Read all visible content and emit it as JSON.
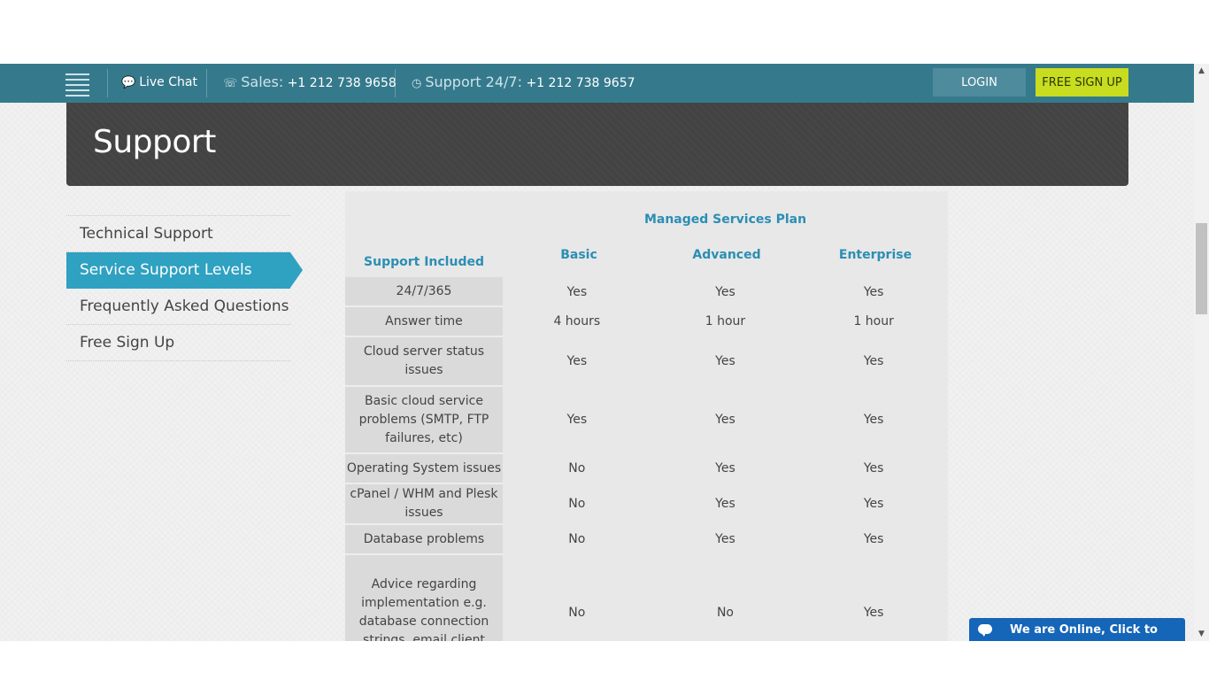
{
  "topbar": {
    "live_chat": "Live Chat",
    "sales_label": "Sales:",
    "sales_number": "+1 212 738 9658",
    "support_label": "Support 24/7:",
    "support_number": "+1 212 738 9657",
    "login": "LOGIN",
    "signup": "FREE SIGN UP"
  },
  "hero": {
    "title": "Support"
  },
  "sidebar": {
    "items": [
      {
        "label": "Technical Support"
      },
      {
        "label": "Service Support Levels"
      },
      {
        "label": "Frequently Asked Questions"
      },
      {
        "label": "Free Sign Up"
      }
    ],
    "active_index": 1
  },
  "table": {
    "plan_title": "Managed Services Plan",
    "support_header": "Support Included",
    "columns": [
      "Basic",
      "Advanced",
      "Enterprise"
    ],
    "rows": [
      {
        "label": "24/7/365",
        "values": [
          "Yes",
          "Yes",
          "Yes"
        ]
      },
      {
        "label": "Answer time",
        "values": [
          "4 hours",
          "1 hour",
          "1 hour"
        ]
      },
      {
        "label": "Cloud server status issues",
        "values": [
          "Yes",
          "Yes",
          "Yes"
        ]
      },
      {
        "label": "Basic cloud service problems (SMTP, FTP failures, etc)",
        "values": [
          "Yes",
          "Yes",
          "Yes"
        ]
      },
      {
        "label": "Operating System issues",
        "values": [
          "No",
          "Yes",
          "Yes"
        ]
      },
      {
        "label": "cPanel / WHM and Plesk issues",
        "values": [
          "No",
          "Yes",
          "Yes"
        ]
      },
      {
        "label": "Database problems",
        "values": [
          "No",
          "Yes",
          "Yes"
        ]
      },
      {
        "label": "Advice regarding implementation e.g. database connection strings, email client",
        "values": [
          "No",
          "No",
          "Yes"
        ]
      }
    ]
  },
  "chat": {
    "label": "We are Online, Click to Chat"
  },
  "colors": {
    "topbar": "#357a8c",
    "accent": "#2fa1c1",
    "yes": "#a5c021",
    "no": "#d4473f",
    "signup": "#c8dc20",
    "chat": "#1565b8"
  }
}
